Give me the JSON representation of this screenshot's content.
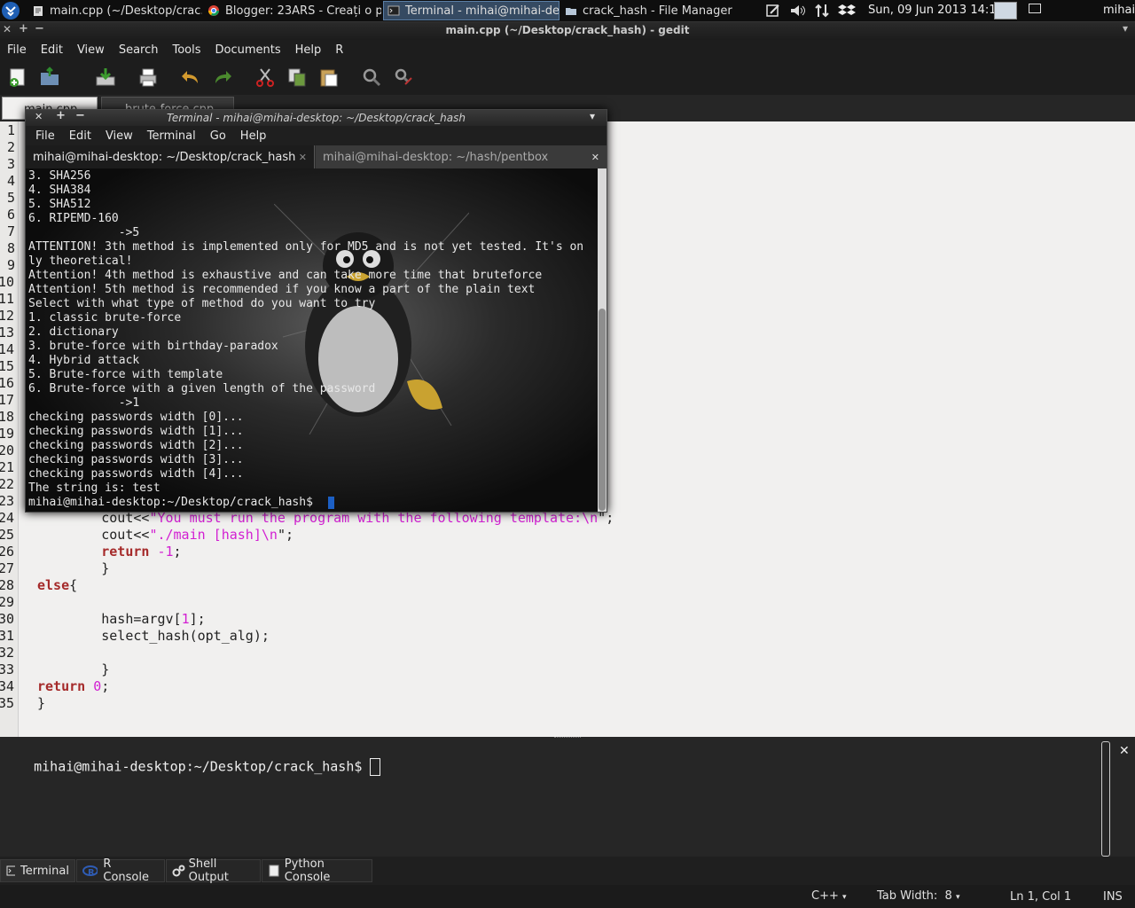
{
  "panel": {
    "tasks": [
      {
        "label": "main.cpp (~/Desktop/crac...",
        "icon": "text-editor-icon"
      },
      {
        "label": "Blogger: 23ARS - Creați o p...",
        "icon": "chrome-icon"
      },
      {
        "label": "Terminal - mihai@mihai-de...",
        "icon": "terminal-icon"
      },
      {
        "label": "crack_hash - File Manager",
        "icon": "folder-icon"
      }
    ],
    "clock": "Sun, 09 Jun 2013 14:14",
    "user": "mihai"
  },
  "gedit": {
    "title": "main.cpp (~/Desktop/crack_hash) - gedit",
    "menu": [
      "File",
      "Edit",
      "View",
      "Search",
      "Tools",
      "Documents",
      "Help",
      "R"
    ],
    "tabs": [
      "main.cpp",
      "brute-force.cpp"
    ],
    "line_numbers": [
      "1",
      "2",
      "3",
      "4",
      "5",
      "6",
      "7",
      "8",
      "9",
      "10",
      "11",
      "12",
      "13",
      "14",
      "15",
      "16",
      "17",
      "18",
      "19",
      "20",
      "21",
      "22",
      "23",
      "24",
      "25",
      "26",
      "27",
      "28",
      "29",
      "30",
      "31",
      "32",
      "33",
      "34",
      "35"
    ],
    "code": {
      "l24_a": "        cout<<",
      "l24_s": "\"You must run the program with the following template:",
      "l24_e": "\\n",
      "l24_t": "\";",
      "l25_a": "        cout<<",
      "l25_s": "\"./main [hash]",
      "l25_e": "\\n",
      "l25_t": "\";",
      "l26_k": "return",
      "l26_n": "-1",
      "l26_t": ";",
      "l27": "        }",
      "l28_k": "else",
      "l28_t": "{",
      "l30_a": "        hash=argv[",
      "l30_n": "1",
      "l30_t": "];",
      "l31": "        select_hash(opt_alg);",
      "l33": "        }",
      "l34_k": "return",
      "l34_n": "0",
      "l34_t": ";",
      "l35": "}"
    }
  },
  "terminal": {
    "title": "Terminal - mihai@mihai-desktop: ~/Desktop/crack_hash",
    "menu": [
      "File",
      "Edit",
      "View",
      "Terminal",
      "Go",
      "Help"
    ],
    "tabs": [
      "mihai@mihai-desktop: ~/Desktop/crack_hash",
      "mihai@mihai-desktop: ~/hash/pentbox"
    ],
    "lines": [
      "3. SHA256",
      "4. SHA384",
      "5. SHA512",
      "6. RIPEMD-160",
      "             ->5",
      "ATTENTION! 3th method is implemented only for MD5 and is not yet tested. It's on",
      "ly theoretical!",
      "Attention! 4th method is exhaustive and can take more time that bruteforce",
      "Attention! 5th method is recommended if you know a part of the plain text",
      "Select with what type of method do you want to try",
      "1. classic brute-force",
      "2. dictionary",
      "3. brute-force with birthday-paradox",
      "4. Hybrid attack",
      "5. Brute-force with template",
      "6. Brute-force with a given length of the password",
      "             ->1",
      "checking passwords width [0]...",
      "checking passwords width [1]...",
      "checking passwords width [2]...",
      "checking passwords width [3]...",
      "checking passwords width [4]...",
      "The string is: test",
      "mihai@mihai-desktop:~/Desktop/crack_hash$ "
    ]
  },
  "bottom": {
    "prompt": "mihai@mihai-desktop:~/Desktop/crack_hash$ ",
    "tabs": [
      "Terminal",
      "R Console",
      "Shell Output",
      "Python Console"
    ]
  },
  "status": {
    "language": "C++",
    "tab_width": "Tab Width:  8",
    "position": "Ln 1, Col 1",
    "mode": "INS"
  }
}
